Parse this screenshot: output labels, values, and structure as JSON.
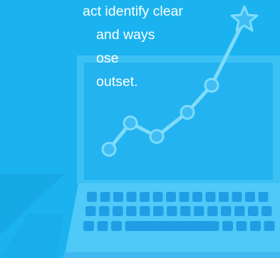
{
  "text": {
    "lines": [
      "act identify clear",
      "and ways",
      "ose",
      "outset."
    ]
  },
  "illustration": {
    "subject": "laptop-growth-chart",
    "icons": [
      "laptop-icon",
      "line-chart-icon",
      "star-icon",
      "keyboard-icon"
    ],
    "colors": {
      "background": "#1ab3f0",
      "background_shadow": "#17a8e6",
      "screen": "#2bb8f2",
      "screen_border": "#4cc8f5",
      "chart_line": "#7fdcfb",
      "chart_point": "#3dbdf4",
      "keyboard_base": "#47c6f7",
      "key": "#1f9ee6",
      "text": "#ffffff"
    }
  }
}
